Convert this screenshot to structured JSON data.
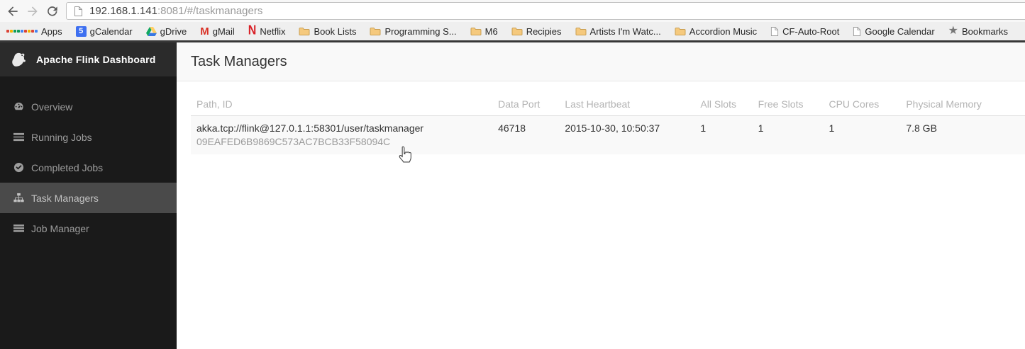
{
  "browser": {
    "url": {
      "host": "192.168.1.141",
      "path": ":8081/#/taskmanagers"
    },
    "bookmarks": [
      {
        "icon": "apps-grid-icon",
        "label": "Apps"
      },
      {
        "icon": "calendar-5-icon",
        "label": "gCalendar"
      },
      {
        "icon": "google-drive-icon",
        "label": "gDrive"
      },
      {
        "icon": "gmail-icon",
        "label": "gMail"
      },
      {
        "icon": "netflix-icon",
        "label": "Netflix"
      },
      {
        "icon": "folder-icon",
        "label": "Book Lists"
      },
      {
        "icon": "folder-icon",
        "label": "Programming S..."
      },
      {
        "icon": "folder-icon",
        "label": "M6"
      },
      {
        "icon": "folder-icon",
        "label": "Recipies"
      },
      {
        "icon": "folder-icon",
        "label": "Artists I'm Watc..."
      },
      {
        "icon": "folder-icon",
        "label": "Accordion Music"
      },
      {
        "icon": "page-icon",
        "label": "CF-Auto-Root"
      },
      {
        "icon": "page-icon",
        "label": "Google Calendar"
      },
      {
        "icon": "star-icon",
        "label": "Bookmarks"
      }
    ]
  },
  "sidebar": {
    "title": "Apache Flink Dashboard",
    "items": [
      {
        "icon": "gauge-icon",
        "label": "Overview",
        "active": false
      },
      {
        "icon": "tasks-icon",
        "label": "Running Jobs",
        "active": false
      },
      {
        "icon": "check-circle-icon",
        "label": "Completed Jobs",
        "active": false
      },
      {
        "icon": "sitemap-icon",
        "label": "Task Managers",
        "active": true
      },
      {
        "icon": "list-icon",
        "label": "Job Manager",
        "active": false
      }
    ]
  },
  "main": {
    "title": "Task Managers",
    "table": {
      "columns": [
        "Path, ID",
        "Data Port",
        "Last Heartbeat",
        "All Slots",
        "Free Slots",
        "CPU Cores",
        "Physical Memory"
      ],
      "rows": [
        {
          "path": "akka.tcp://flink@127.0.1.1:58301/user/taskmanager",
          "id": "09EAFED6B9869C573AC7BCB33F58094C",
          "data_port": "46718",
          "last_heartbeat": "2015-10-30, 10:50:37",
          "all_slots": "1",
          "free_slots": "1",
          "cpu_cores": "1",
          "physical_memory": "7.8 GB"
        }
      ]
    }
  },
  "colors": {
    "sidebar_bg": "#1a1a1a",
    "sidebar_header_bg": "#2b2b2b",
    "sidebar_active_bg": "#4a4a4a",
    "sidebar_text": "#9d9d9d",
    "titlebar_bg": "#f9f9f9",
    "row_stripe_bg": "#f9f9f9",
    "muted_text": "#999999",
    "divider_dark": "#383838",
    "folder_yellow": "#f5c97d",
    "netflix_red": "#d81f26",
    "gmail_red": "#d93025",
    "calendar_blue": "#3d6ff0"
  }
}
